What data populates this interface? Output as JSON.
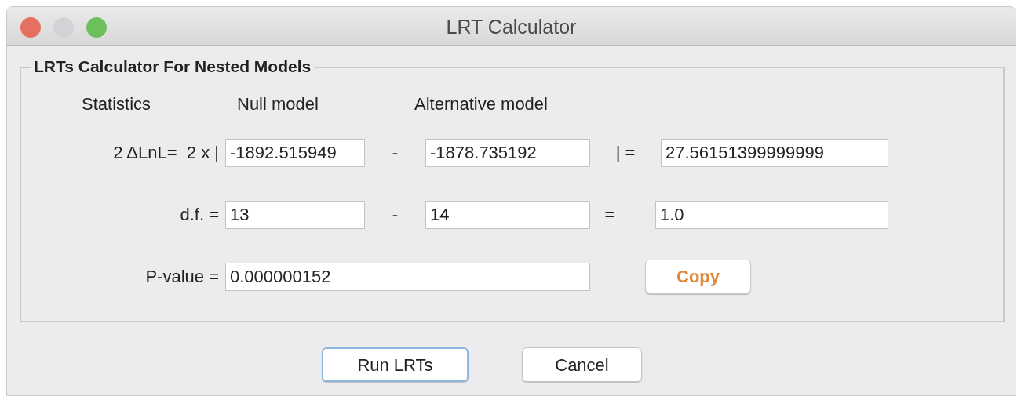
{
  "window": {
    "title": "LRT Calculator"
  },
  "group": {
    "title": "LRTs Calculator For Nested Models"
  },
  "headers": [
    "Statistics",
    "Null model",
    "Alternative model"
  ],
  "rows": [
    {
      "label": "2 ΔLnL=  2 x |",
      "null_value": "-1892.515949",
      "minus": "-",
      "alt_value": "-1878.735192",
      "equals": "| =",
      "result": "27.56151399999999"
    },
    {
      "label": "d.f. =",
      "null_value": "13",
      "minus": "-",
      "alt_value": "14",
      "equals": "=",
      "result": "1.0"
    }
  ],
  "p_value": {
    "label": "P-value =",
    "value": "0.000000152"
  },
  "copy_button": {
    "label": "Copy"
  },
  "buttons": [
    {
      "label": "Run LRTs",
      "default": true
    },
    {
      "label": "Cancel",
      "default": false
    }
  ]
}
